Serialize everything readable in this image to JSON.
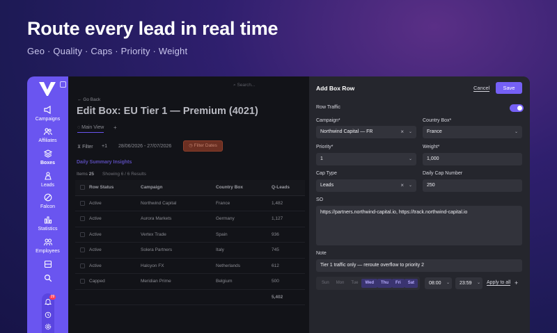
{
  "hero": {
    "title": "Route every lead in real time",
    "subtitle": "Geo  ·  Quality  ·  Caps  ·  Priority  ·  Weight"
  },
  "sidebar": {
    "items": [
      {
        "label": "Campaigns",
        "icon": "megaphone-icon"
      },
      {
        "label": "Affiliates",
        "icon": "users-icon"
      },
      {
        "label": "Boxes",
        "icon": "layers-icon"
      },
      {
        "label": "Leads",
        "icon": "leads-icon"
      },
      {
        "label": "Falcon",
        "icon": "falcon-icon"
      },
      {
        "label": "Statistics",
        "icon": "bar-chart-icon"
      },
      {
        "label": "Employees",
        "icon": "employees-icon"
      }
    ],
    "notification_count": "29"
  },
  "main": {
    "search_placeholder": "Search...",
    "go_back": "Go Back",
    "title": "Edit Box: EU Tier 1 — Premium (4021)",
    "tab": "Main View",
    "filter_label": "Filter",
    "filter_count": "+1",
    "date_range": "28/06/2026 - 27/07/2026",
    "filter_dates": "Filter Dates",
    "insights_title": "Daily Summary Insights",
    "items_label": "Items",
    "items_count": "25",
    "showing": "Showing 6 / 6 Results",
    "columns": [
      "Row Status",
      "Campaign",
      "Country Box",
      "Q-Leads"
    ],
    "rows": [
      {
        "status": "Active",
        "campaign": "Northwind Capital",
        "country": "France",
        "qleads": "1,482"
      },
      {
        "status": "Active",
        "campaign": "Aurora Markets",
        "country": "Germany",
        "qleads": "1,127"
      },
      {
        "status": "Active",
        "campaign": "Vertex Trade",
        "country": "Spain",
        "qleads": "936"
      },
      {
        "status": "Active",
        "campaign": "Solera Partners",
        "country": "Italy",
        "qleads": "745"
      },
      {
        "status": "Active",
        "campaign": "Halcyon FX",
        "country": "Netherlands",
        "qleads": "612"
      },
      {
        "status": "Capped",
        "campaign": "Meridian Prime",
        "country": "Belgium",
        "qleads": "500"
      }
    ],
    "total": "5,402"
  },
  "panel": {
    "title": "Add Box Row",
    "cancel": "Cancel",
    "save": "Save",
    "row_traffic_label": "Row Traffic",
    "row_traffic_on": true,
    "campaign_label": "Campaign*",
    "campaign_value": "Northwind Capital — FR",
    "country_box_label": "Country Box*",
    "country_box_value": "France",
    "priority_label": "Priority*",
    "priority_value": "1",
    "weight_label": "Weight*",
    "weight_value": "1,000",
    "cap_type_label": "Cap Type",
    "cap_type_value": "Leads",
    "daily_cap_label": "Daily Cap Number",
    "daily_cap_value": "250",
    "so_label": "SO",
    "so_value": "https://partners.northwind-capital.io, https://track.northwind-capital.io",
    "note_label": "Note",
    "note_value": "Tier 1 traffic only — reroute overflow to priority 2",
    "days": [
      {
        "label": "Sun",
        "on": false
      },
      {
        "label": "Mon",
        "on": false
      },
      {
        "label": "Tue",
        "on": false
      },
      {
        "label": "Wed",
        "on": true
      },
      {
        "label": "Thu",
        "on": true
      },
      {
        "label": "Fri",
        "on": true
      },
      {
        "label": "Sat",
        "on": true
      }
    ],
    "time_from": "08:00",
    "time_to": "23:59",
    "apply_to_all": "Apply to all",
    "accent_color": "#7560f5"
  }
}
